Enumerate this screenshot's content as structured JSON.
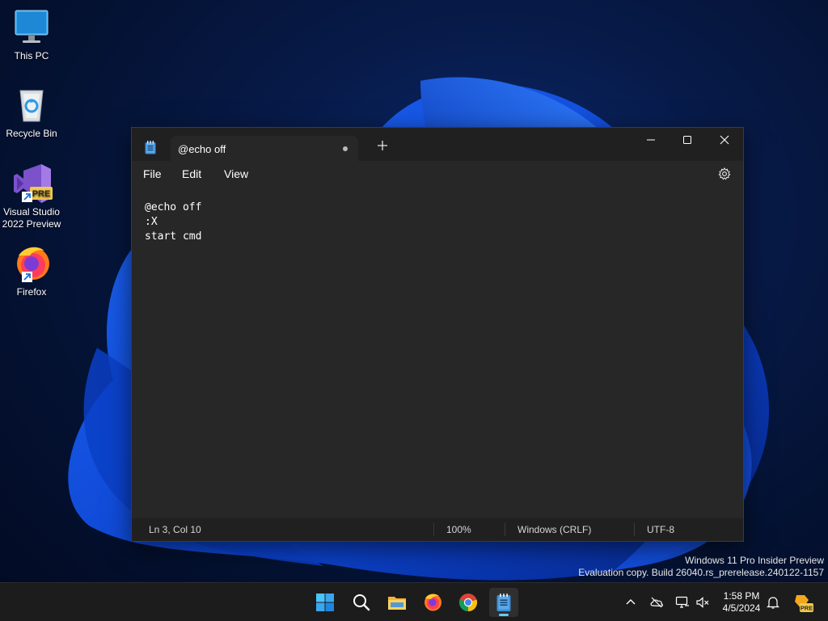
{
  "desktop": {
    "icons": [
      {
        "label": "This PC",
        "icon": "monitor-icon"
      },
      {
        "label": "Recycle Bin",
        "icon": "recycle-bin-icon"
      },
      {
        "label_line1": "Visual Studio",
        "label_line2": "2022 Preview",
        "badge": "PRE",
        "icon": "visual-studio-icon"
      },
      {
        "label": "Firefox",
        "icon": "firefox-icon"
      }
    ]
  },
  "notepad": {
    "tab_title": "@echo off",
    "menu": [
      "File",
      "Edit",
      "View"
    ],
    "lines": [
      "@echo off",
      ":X",
      "start cmd"
    ],
    "status": {
      "position": "Ln 3, Col 10",
      "zoom": "100%",
      "line_ending": "Windows (CRLF)",
      "encoding": "UTF-8"
    }
  },
  "watermark": {
    "line1": "Windows 11 Pro Insider Preview",
    "line2": "Evaluation copy. Build 26040.rs_prerelease.240122-1157"
  },
  "taskbar": {
    "apps": [
      "start-icon",
      "search-icon",
      "file-explorer-icon",
      "firefox-icon",
      "chrome-icon",
      "notepad-icon"
    ],
    "tray": [
      "chevron-up-icon",
      "onedrive-icon",
      "network-icon",
      "volume-muted-icon",
      "notification-bell-icon",
      "dev-badge-icon"
    ],
    "time": "1:58 PM",
    "date": "4/5/2024",
    "tray_badge": "PRE"
  },
  "colors": {
    "window_bg": "#272727",
    "titlebar_bg": "#202020",
    "taskbar_bg": "#1c1c1c",
    "accent": "#60cdff"
  }
}
